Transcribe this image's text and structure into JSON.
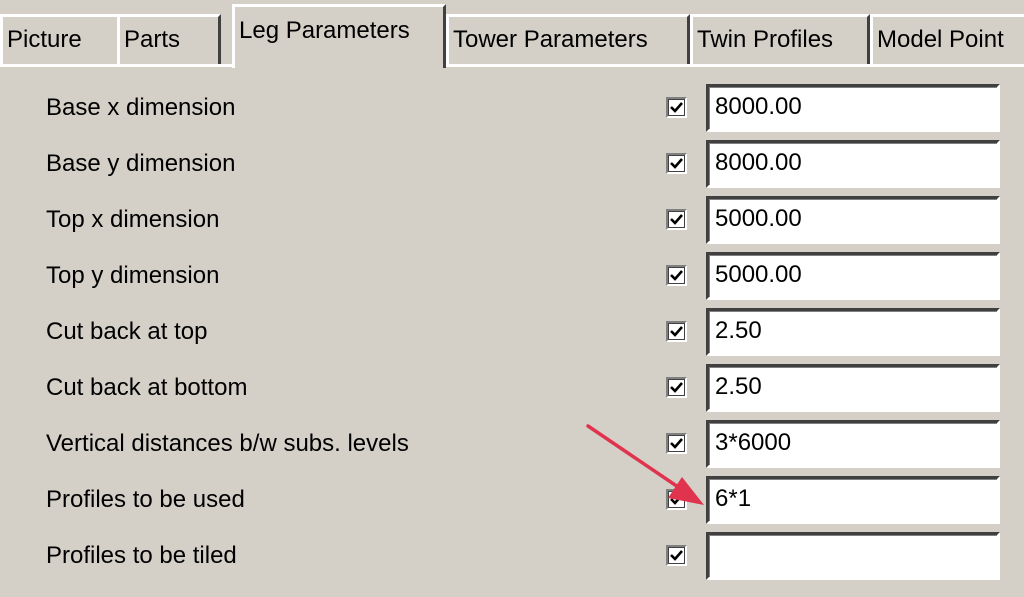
{
  "tabs": [
    {
      "label": "Picture"
    },
    {
      "label": "Parts"
    },
    {
      "label": "Leg Parameters"
    },
    {
      "label": "Tower Parameters"
    },
    {
      "label": "Twin Profiles"
    },
    {
      "label": "Model Point"
    }
  ],
  "active_tab": "Leg Parameters",
  "params": [
    {
      "label": "Base x dimension",
      "checked": true,
      "value": "8000.00"
    },
    {
      "label": "Base y dimension",
      "checked": true,
      "value": "8000.00"
    },
    {
      "label": "Top x dimension",
      "checked": true,
      "value": "5000.00"
    },
    {
      "label": "Top y dimension",
      "checked": true,
      "value": "5000.00"
    },
    {
      "label": "Cut back at top",
      "checked": true,
      "value": "2.50"
    },
    {
      "label": "Cut back at bottom",
      "checked": true,
      "value": "2.50"
    },
    {
      "label": "Vertical distances b/w subs. levels",
      "checked": true,
      "value": "3*6000"
    },
    {
      "label": "Profiles to be used",
      "checked": true,
      "value": "6*1"
    },
    {
      "label": "Profiles to be tiled",
      "checked": true,
      "value": ""
    }
  ],
  "annotation": {
    "icon": "arrow-icon",
    "color": "#e0334d"
  }
}
